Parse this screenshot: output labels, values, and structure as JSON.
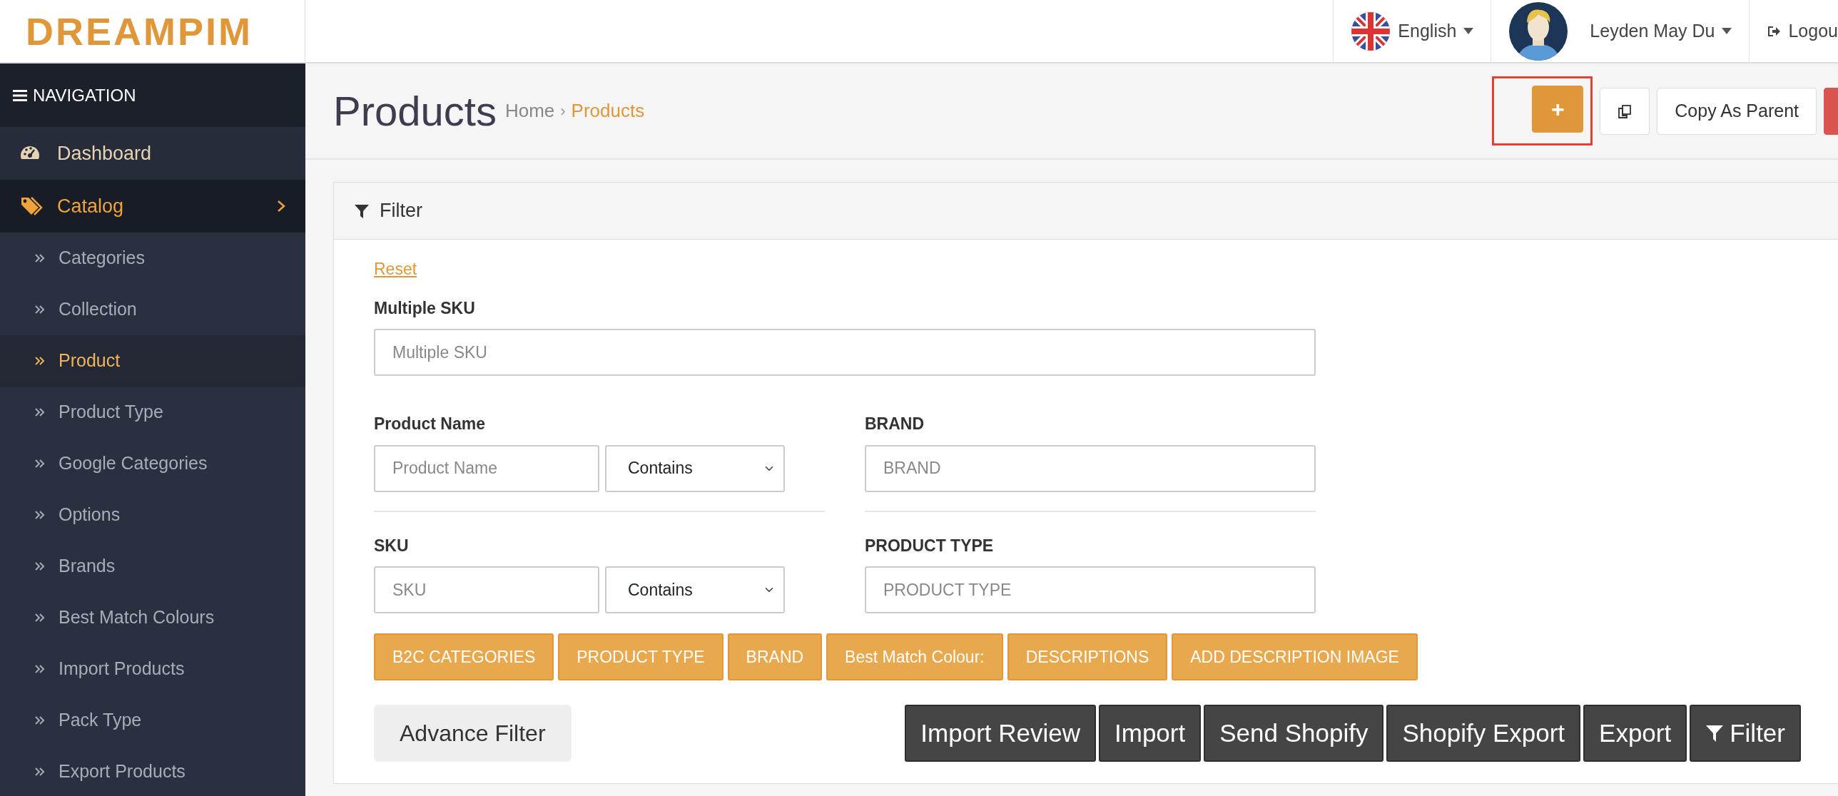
{
  "logo": "DREAMPIM",
  "top_bar": {
    "language": "English",
    "user": "Leyden May Du",
    "logout": "Logou"
  },
  "sidebar": {
    "header": "NAVIGATION",
    "items": [
      {
        "label": "Dashboard",
        "kind": "dashboard",
        "selected": false
      },
      {
        "label": "Catalog",
        "kind": "catalog",
        "selected": true,
        "children": [
          {
            "label": "Categories",
            "selected": false
          },
          {
            "label": "Collection",
            "selected": false
          },
          {
            "label": "Product",
            "selected": true
          },
          {
            "label": "Product Type",
            "selected": false
          },
          {
            "label": "Google Categories",
            "selected": false
          },
          {
            "label": "Options",
            "selected": false
          },
          {
            "label": "Brands",
            "selected": false
          },
          {
            "label": "Best Match Colours",
            "selected": false
          },
          {
            "label": "Import Products",
            "selected": false
          },
          {
            "label": "Pack Type",
            "selected": false
          },
          {
            "label": "Export Products",
            "selected": false
          }
        ]
      }
    ]
  },
  "page": {
    "title": "Products",
    "breadcrumb": [
      "Home",
      "Products"
    ],
    "breadcrumb_separator": "›",
    "header_buttons": [
      {
        "kind": "add",
        "label": "+",
        "highlighted": true
      },
      {
        "kind": "copy",
        "highlighted": false
      },
      {
        "kind": "text",
        "label": "Copy As Parent",
        "highlighted": false
      },
      {
        "kind": "delete",
        "highlighted": false
      }
    ]
  },
  "filter": {
    "title": "Filter",
    "reset": "Reset",
    "multiple_sku": {
      "label": "Multiple SKU",
      "placeholder": "Multiple SKU"
    },
    "product_name": {
      "label": "Product Name",
      "placeholder": "Product Name",
      "operator": "Contains"
    },
    "brand": {
      "label": "BRAND",
      "placeholder": "BRAND"
    },
    "sku": {
      "label": "SKU",
      "placeholder": "SKU",
      "operator": "Contains"
    },
    "product_type": {
      "label": "PRODUCT TYPE",
      "placeholder": "PRODUCT TYPE"
    },
    "tag_buttons": [
      "B2C CATEGORIES",
      "PRODUCT TYPE",
      "BRAND",
      "Best Match Colour:",
      "DESCRIPTIONS",
      "ADD DESCRIPTION IMAGE"
    ],
    "advance_filter": "Advance Filter",
    "action_buttons": [
      {
        "kind": "text",
        "label": "Import Review"
      },
      {
        "kind": "text",
        "label": "Import"
      },
      {
        "kind": "text",
        "label": "Send Shopify"
      },
      {
        "kind": "text",
        "label": "Shopify Export"
      },
      {
        "kind": "text",
        "label": "Export"
      },
      {
        "kind": "filter",
        "label": "Filter"
      }
    ]
  }
}
